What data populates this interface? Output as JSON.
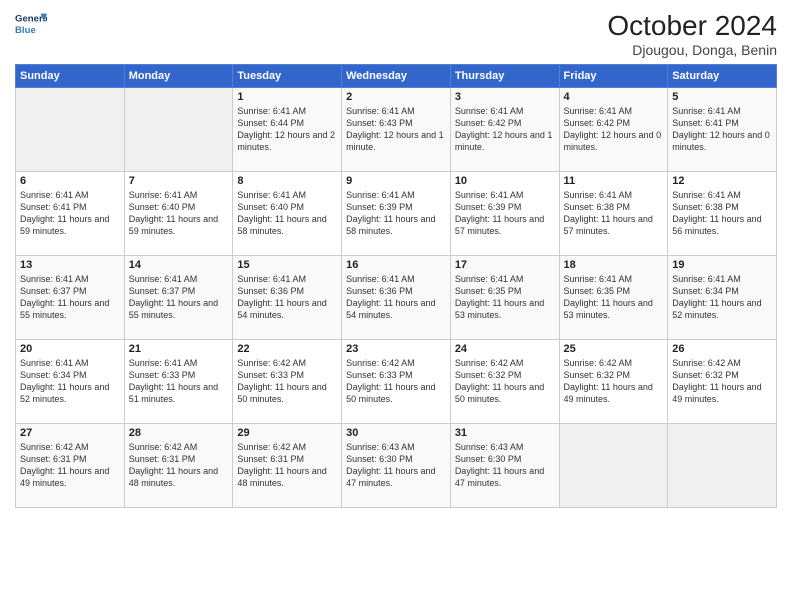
{
  "logo": {
    "line1": "General",
    "line2": "Blue"
  },
  "title": "October 2024",
  "location": "Djougou, Donga, Benin",
  "days_header": [
    "Sunday",
    "Monday",
    "Tuesday",
    "Wednesday",
    "Thursday",
    "Friday",
    "Saturday"
  ],
  "weeks": [
    [
      {
        "num": "",
        "sunrise": "",
        "sunset": "",
        "daylight": ""
      },
      {
        "num": "",
        "sunrise": "",
        "sunset": "",
        "daylight": ""
      },
      {
        "num": "1",
        "sunrise": "Sunrise: 6:41 AM",
        "sunset": "Sunset: 6:44 PM",
        "daylight": "Daylight: 12 hours and 2 minutes."
      },
      {
        "num": "2",
        "sunrise": "Sunrise: 6:41 AM",
        "sunset": "Sunset: 6:43 PM",
        "daylight": "Daylight: 12 hours and 1 minute."
      },
      {
        "num": "3",
        "sunrise": "Sunrise: 6:41 AM",
        "sunset": "Sunset: 6:42 PM",
        "daylight": "Daylight: 12 hours and 1 minute."
      },
      {
        "num": "4",
        "sunrise": "Sunrise: 6:41 AM",
        "sunset": "Sunset: 6:42 PM",
        "daylight": "Daylight: 12 hours and 0 minutes."
      },
      {
        "num": "5",
        "sunrise": "Sunrise: 6:41 AM",
        "sunset": "Sunset: 6:41 PM",
        "daylight": "Daylight: 12 hours and 0 minutes."
      }
    ],
    [
      {
        "num": "6",
        "sunrise": "Sunrise: 6:41 AM",
        "sunset": "Sunset: 6:41 PM",
        "daylight": "Daylight: 11 hours and 59 minutes."
      },
      {
        "num": "7",
        "sunrise": "Sunrise: 6:41 AM",
        "sunset": "Sunset: 6:40 PM",
        "daylight": "Daylight: 11 hours and 59 minutes."
      },
      {
        "num": "8",
        "sunrise": "Sunrise: 6:41 AM",
        "sunset": "Sunset: 6:40 PM",
        "daylight": "Daylight: 11 hours and 58 minutes."
      },
      {
        "num": "9",
        "sunrise": "Sunrise: 6:41 AM",
        "sunset": "Sunset: 6:39 PM",
        "daylight": "Daylight: 11 hours and 58 minutes."
      },
      {
        "num": "10",
        "sunrise": "Sunrise: 6:41 AM",
        "sunset": "Sunset: 6:39 PM",
        "daylight": "Daylight: 11 hours and 57 minutes."
      },
      {
        "num": "11",
        "sunrise": "Sunrise: 6:41 AM",
        "sunset": "Sunset: 6:38 PM",
        "daylight": "Daylight: 11 hours and 57 minutes."
      },
      {
        "num": "12",
        "sunrise": "Sunrise: 6:41 AM",
        "sunset": "Sunset: 6:38 PM",
        "daylight": "Daylight: 11 hours and 56 minutes."
      }
    ],
    [
      {
        "num": "13",
        "sunrise": "Sunrise: 6:41 AM",
        "sunset": "Sunset: 6:37 PM",
        "daylight": "Daylight: 11 hours and 55 minutes."
      },
      {
        "num": "14",
        "sunrise": "Sunrise: 6:41 AM",
        "sunset": "Sunset: 6:37 PM",
        "daylight": "Daylight: 11 hours and 55 minutes."
      },
      {
        "num": "15",
        "sunrise": "Sunrise: 6:41 AM",
        "sunset": "Sunset: 6:36 PM",
        "daylight": "Daylight: 11 hours and 54 minutes."
      },
      {
        "num": "16",
        "sunrise": "Sunrise: 6:41 AM",
        "sunset": "Sunset: 6:36 PM",
        "daylight": "Daylight: 11 hours and 54 minutes."
      },
      {
        "num": "17",
        "sunrise": "Sunrise: 6:41 AM",
        "sunset": "Sunset: 6:35 PM",
        "daylight": "Daylight: 11 hours and 53 minutes."
      },
      {
        "num": "18",
        "sunrise": "Sunrise: 6:41 AM",
        "sunset": "Sunset: 6:35 PM",
        "daylight": "Daylight: 11 hours and 53 minutes."
      },
      {
        "num": "19",
        "sunrise": "Sunrise: 6:41 AM",
        "sunset": "Sunset: 6:34 PM",
        "daylight": "Daylight: 11 hours and 52 minutes."
      }
    ],
    [
      {
        "num": "20",
        "sunrise": "Sunrise: 6:41 AM",
        "sunset": "Sunset: 6:34 PM",
        "daylight": "Daylight: 11 hours and 52 minutes."
      },
      {
        "num": "21",
        "sunrise": "Sunrise: 6:41 AM",
        "sunset": "Sunset: 6:33 PM",
        "daylight": "Daylight: 11 hours and 51 minutes."
      },
      {
        "num": "22",
        "sunrise": "Sunrise: 6:42 AM",
        "sunset": "Sunset: 6:33 PM",
        "daylight": "Daylight: 11 hours and 50 minutes."
      },
      {
        "num": "23",
        "sunrise": "Sunrise: 6:42 AM",
        "sunset": "Sunset: 6:33 PM",
        "daylight": "Daylight: 11 hours and 50 minutes."
      },
      {
        "num": "24",
        "sunrise": "Sunrise: 6:42 AM",
        "sunset": "Sunset: 6:32 PM",
        "daylight": "Daylight: 11 hours and 50 minutes."
      },
      {
        "num": "25",
        "sunrise": "Sunrise: 6:42 AM",
        "sunset": "Sunset: 6:32 PM",
        "daylight": "Daylight: 11 hours and 49 minutes."
      },
      {
        "num": "26",
        "sunrise": "Sunrise: 6:42 AM",
        "sunset": "Sunset: 6:32 PM",
        "daylight": "Daylight: 11 hours and 49 minutes."
      }
    ],
    [
      {
        "num": "27",
        "sunrise": "Sunrise: 6:42 AM",
        "sunset": "Sunset: 6:31 PM",
        "daylight": "Daylight: 11 hours and 49 minutes."
      },
      {
        "num": "28",
        "sunrise": "Sunrise: 6:42 AM",
        "sunset": "Sunset: 6:31 PM",
        "daylight": "Daylight: 11 hours and 48 minutes."
      },
      {
        "num": "29",
        "sunrise": "Sunrise: 6:42 AM",
        "sunset": "Sunset: 6:31 PM",
        "daylight": "Daylight: 11 hours and 48 minutes."
      },
      {
        "num": "30",
        "sunrise": "Sunrise: 6:43 AM",
        "sunset": "Sunset: 6:30 PM",
        "daylight": "Daylight: 11 hours and 47 minutes."
      },
      {
        "num": "31",
        "sunrise": "Sunrise: 6:43 AM",
        "sunset": "Sunset: 6:30 PM",
        "daylight": "Daylight: 11 hours and 47 minutes."
      },
      {
        "num": "",
        "sunrise": "",
        "sunset": "",
        "daylight": ""
      },
      {
        "num": "",
        "sunrise": "",
        "sunset": "",
        "daylight": ""
      }
    ]
  ]
}
